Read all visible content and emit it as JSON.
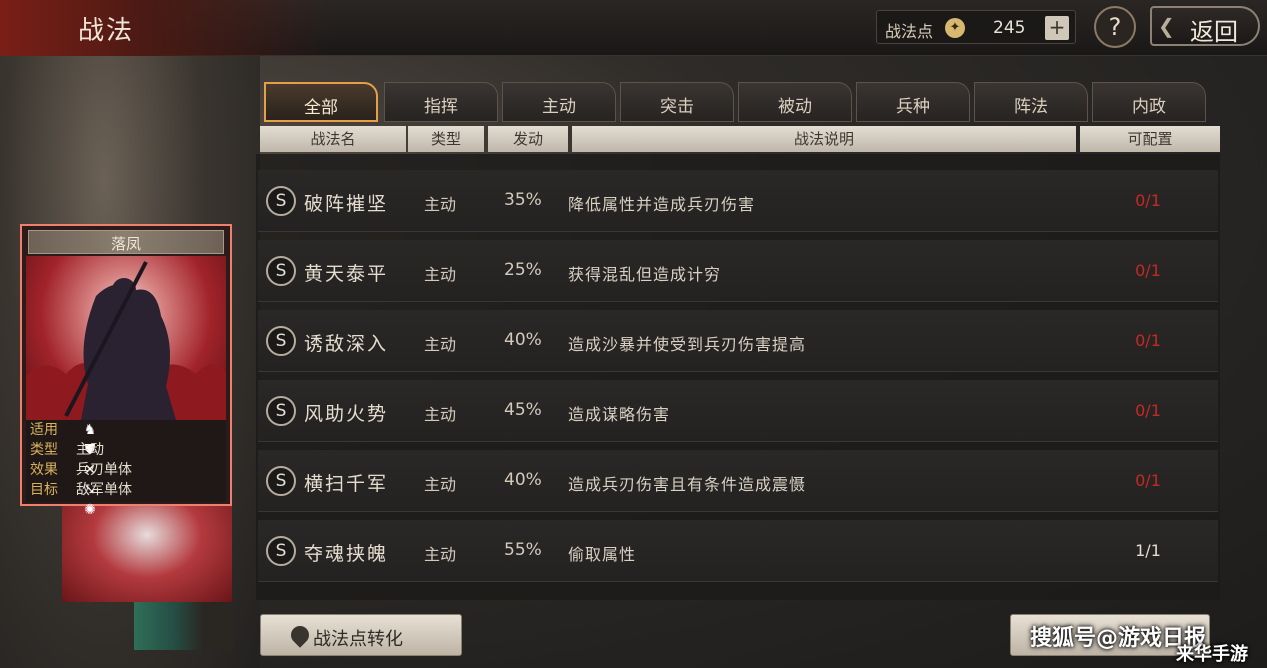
{
  "header": {
    "title": "战法",
    "points_label": "战法点",
    "points_value": "245",
    "plus": "+",
    "help": "?",
    "back": "返回"
  },
  "hero": {
    "name": "落凤",
    "info": [
      {
        "key": "适用",
        "value": ""
      },
      {
        "key": "类型",
        "value": "主动"
      },
      {
        "key": "效果",
        "value": "兵刃单体"
      },
      {
        "key": "目标",
        "value": "敌军单体"
      }
    ],
    "unit_icons": [
      "cavalry-icon",
      "shield-icon",
      "bow-icon",
      "spear-icon",
      "chariot-icon"
    ]
  },
  "tabs": [
    {
      "label": "全部",
      "active": true
    },
    {
      "label": "指挥",
      "active": false
    },
    {
      "label": "主动",
      "active": false
    },
    {
      "label": "突击",
      "active": false
    },
    {
      "label": "被动",
      "active": false
    },
    {
      "label": "兵种",
      "active": false
    },
    {
      "label": "阵法",
      "active": false
    },
    {
      "label": "内政",
      "active": false
    }
  ],
  "table": {
    "headers": [
      "战法名",
      "类型",
      "发动",
      "战法说明",
      "可配置"
    ],
    "rows": [
      {
        "grade": "S",
        "name": "破阵摧坚",
        "type": "主动",
        "rate": "35%",
        "desc": "降低属性并造成兵刃伤害",
        "config": "0/1",
        "config_color": "#c42a24"
      },
      {
        "grade": "S",
        "name": "黄天泰平",
        "type": "主动",
        "rate": "25%",
        "desc": "获得混乱但造成计穷",
        "config": "0/1",
        "config_color": "#c42a24"
      },
      {
        "grade": "S",
        "name": "诱敌深入",
        "type": "主动",
        "rate": "40%",
        "desc": "造成沙暴并使受到兵刃伤害提高",
        "config": "0/1",
        "config_color": "#c42a24"
      },
      {
        "grade": "S",
        "name": "风助火势",
        "type": "主动",
        "rate": "45%",
        "desc": "造成谋略伤害",
        "config": "0/1",
        "config_color": "#c42a24"
      },
      {
        "grade": "S",
        "name": "横扫千军",
        "type": "主动",
        "rate": "40%",
        "desc": "造成兵刃伤害且有条件造成震慑",
        "config": "0/1",
        "config_color": "#c42a24"
      },
      {
        "grade": "S",
        "name": "夺魂挟魄",
        "type": "主动",
        "rate": "55%",
        "desc": "偷取属性",
        "config": "1/1",
        "config_color": "#e4ddcf"
      }
    ]
  },
  "footer": {
    "convert_label": "战法点转化"
  },
  "watermark": {
    "line1": "搜狐号@游戏日报",
    "line2": "来华手游"
  }
}
